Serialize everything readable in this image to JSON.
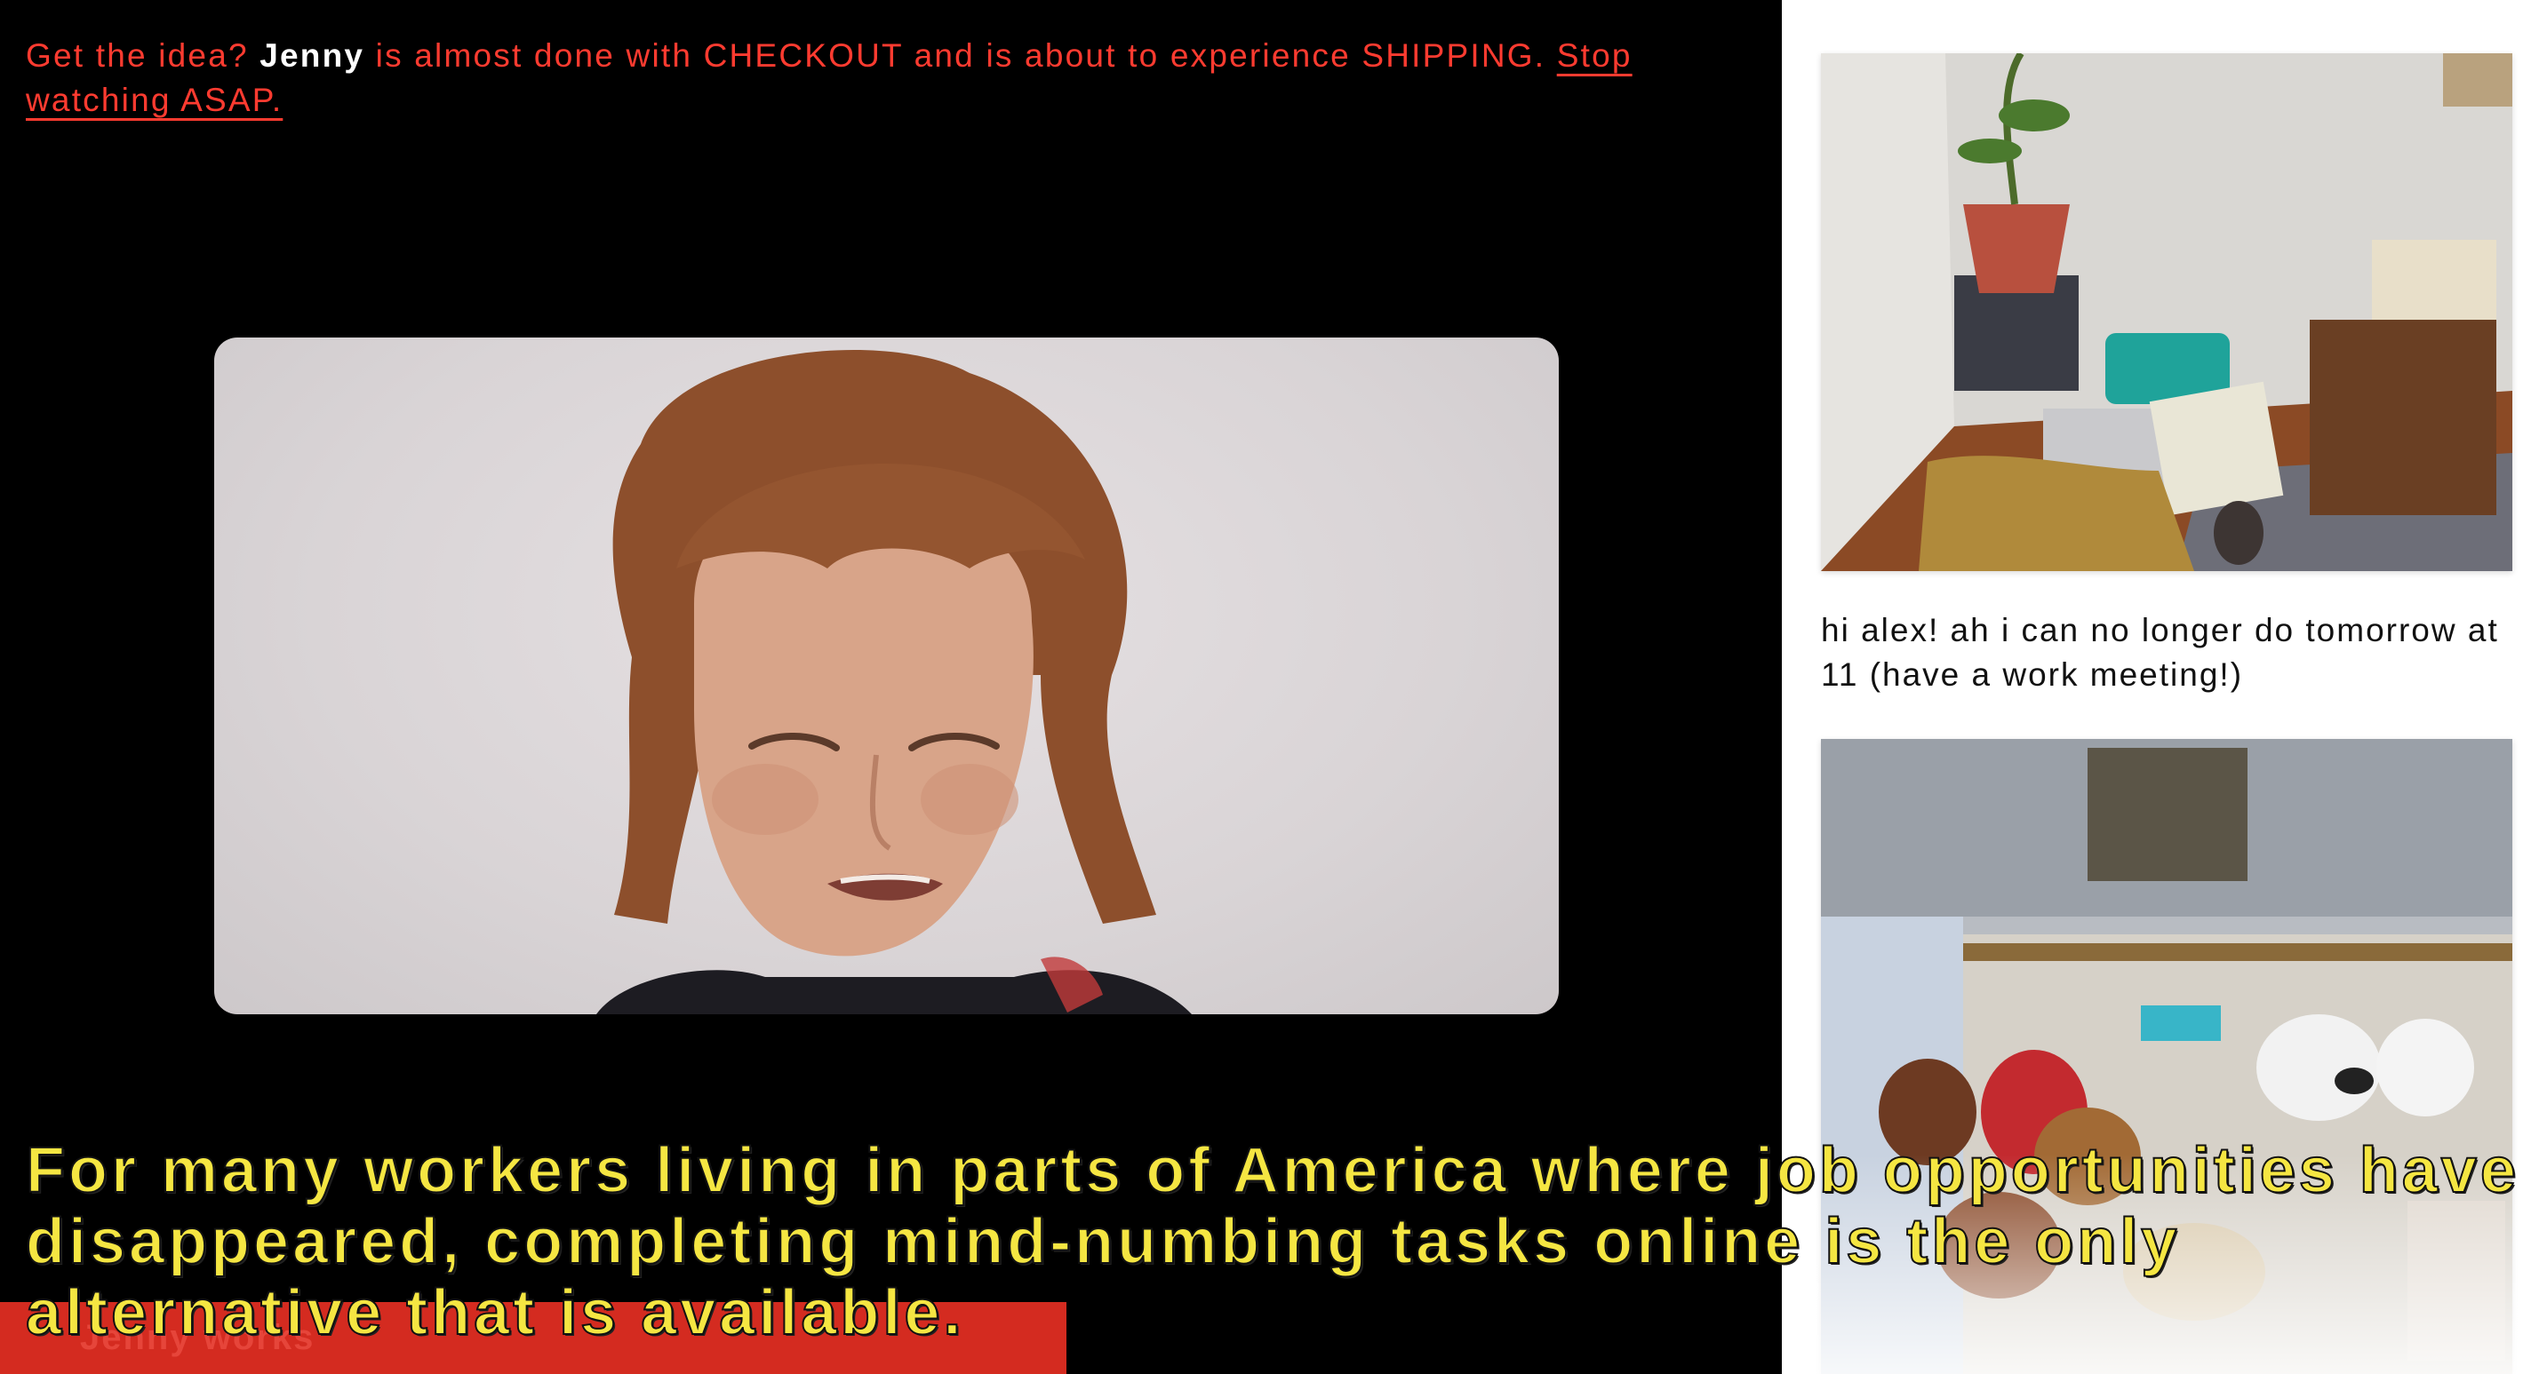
{
  "banner": {
    "prefix": "Get the idea?",
    "name": "Jenny",
    "middle": "is almost done with CHECKOUT and is about to experience SHIPPING.",
    "link": "Stop watching ASAP."
  },
  "video": {
    "description_icon": "video-feed-person"
  },
  "caption": {
    "text": "For many workers living in parts of America where job opportunities have disappeared, completing mind-numbing tasks online is the only alternative that is available."
  },
  "namebar": {
    "label": "Jenny works"
  },
  "sidebar": {
    "chat_message": "hi alex! ah i can no longer do tomorrow at 11 (have a work meeting!)"
  },
  "colors": {
    "banner_text": "#ff3b30",
    "caption_text": "#f5e642",
    "namebar_bg": "#d42b20"
  }
}
